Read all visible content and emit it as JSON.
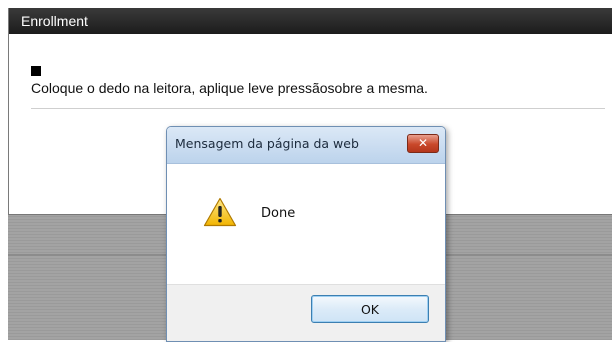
{
  "enrollment": {
    "title": "Enrollment",
    "instruction": "Coloque o dedo na leitora, aplique leve pressãosobre a mesma."
  },
  "dialog": {
    "title": "Mensagem da página da web",
    "close_label": "✕",
    "message": "Done",
    "ok_label": "OK",
    "icon": "warning-icon"
  },
  "colors": {
    "titlebar": "#1c1c1c",
    "dialog_title_bg": "#bcd3ec",
    "close_red": "#c9482a",
    "ok_border": "#3c7fb1"
  }
}
